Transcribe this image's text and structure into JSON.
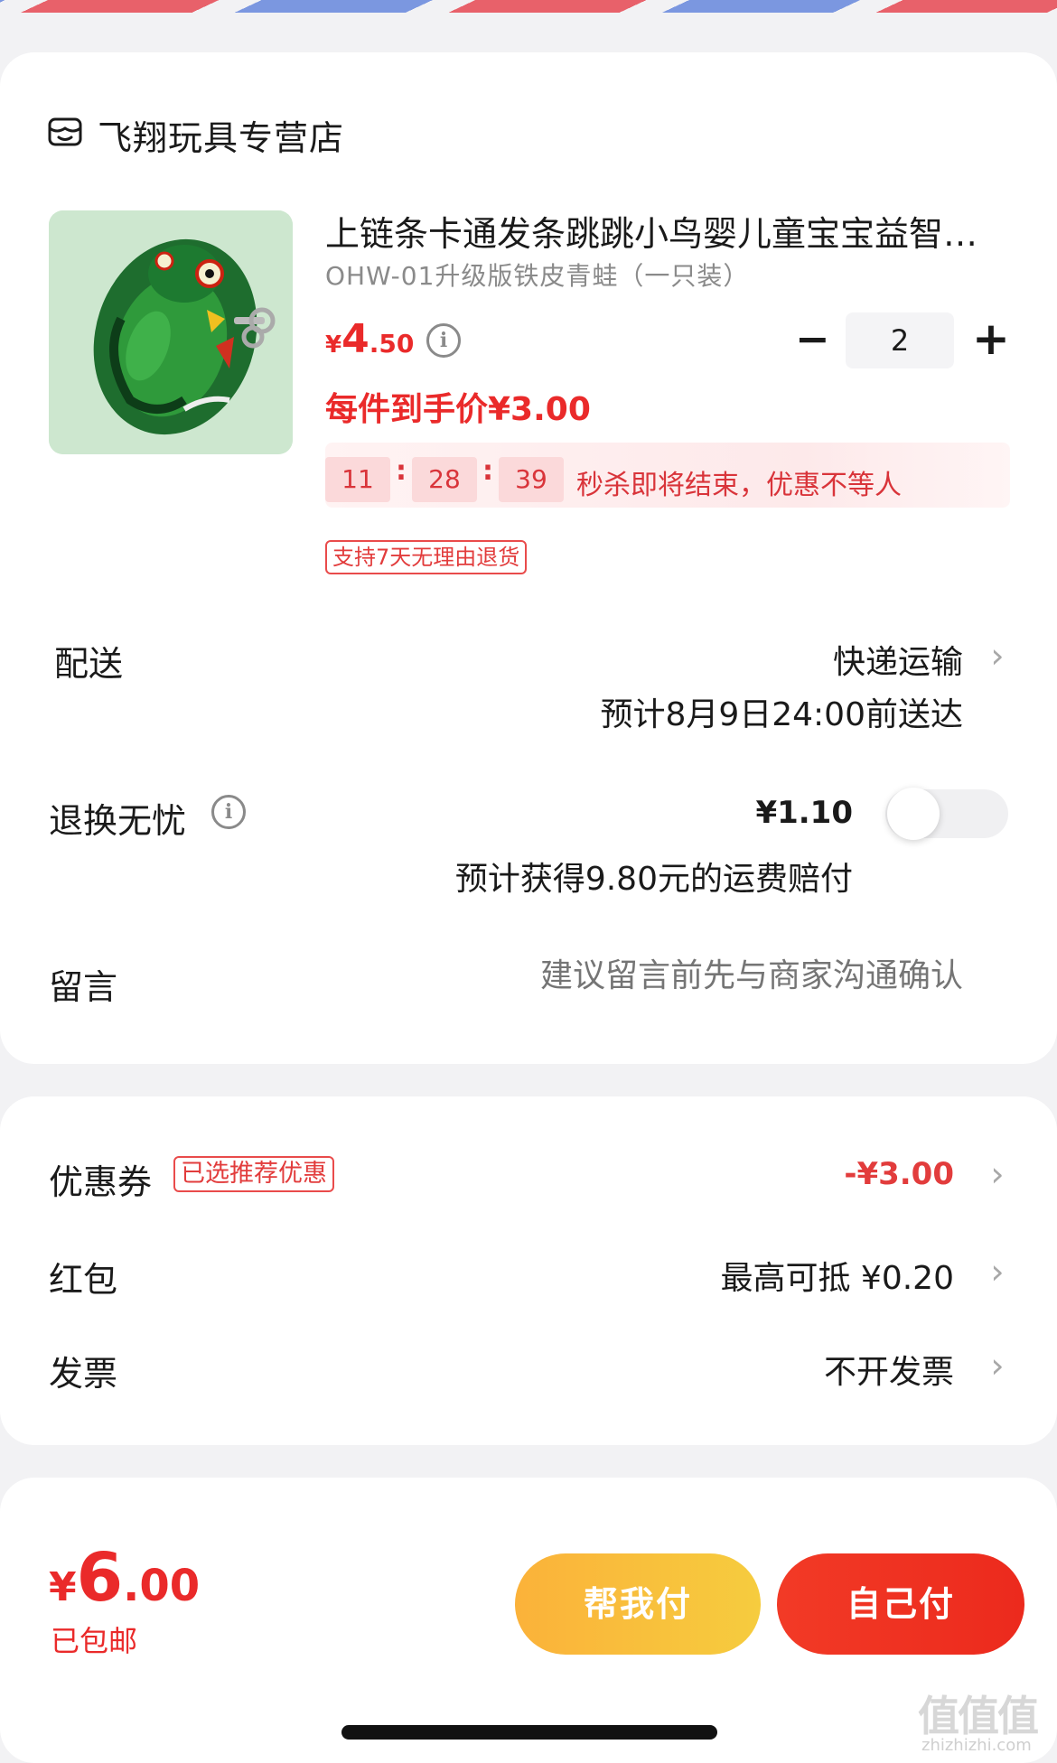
{
  "shop": {
    "name": "飞翔玩具专营店",
    "icon": "shop-icon"
  },
  "product": {
    "title": "上链条卡通发条跳跳小鸟婴儿童宝宝益智…",
    "spec": "OHW-01升级版铁皮青蛙（一只装）",
    "price_currency": "¥",
    "price_int": "4",
    "price_dec": ".50",
    "deal_price": "每件到手价¥3.00",
    "quantity": "2",
    "qty_minus": "−",
    "qty_plus": "+",
    "countdown": {
      "h": "11",
      "m": "28",
      "s": "39",
      "sep": ":",
      "text": "秒杀即将结束，优惠不等人"
    },
    "return_tag": "支持7天无理由退货"
  },
  "shipping": {
    "label": "配送",
    "method": "快递运输",
    "eta": "预计8月9日24:00前送达"
  },
  "return_insurance": {
    "label": "退换无忧",
    "price": "¥1.10",
    "toggle_on": false,
    "sub": "预计获得9.80元的运费赔付"
  },
  "message": {
    "label": "留言",
    "placeholder": "建议留言前先与商家沟通确认"
  },
  "coupon": {
    "label": "优惠券",
    "tag": "已选推荐优惠",
    "value": "-¥3.00"
  },
  "red_packet": {
    "label": "红包",
    "value": "最高可抵 ¥0.20"
  },
  "invoice": {
    "label": "发票",
    "value": "不开发票"
  },
  "footer": {
    "total_currency": "¥",
    "total_int": "6",
    "total_dec": ".00",
    "free_shipping": "已包邮",
    "help_pay": "帮我付",
    "self_pay": "自己付"
  },
  "watermark": {
    "main": "值值值",
    "sub": "zhizhizhi.com"
  },
  "colors": {
    "accent_red": "#ea2a2a",
    "help_btn": "#f6c03c",
    "self_btn": "#ee2f21"
  },
  "chevron": "›"
}
